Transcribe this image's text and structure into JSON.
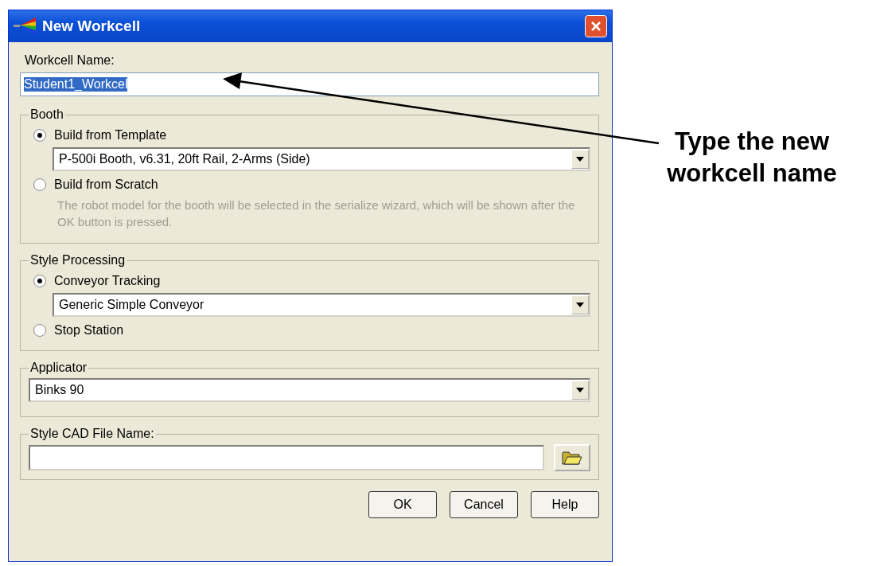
{
  "window": {
    "title": "New Workcell"
  },
  "workcell_name": {
    "label": "Workcell Name:",
    "value": "Student1_Workcel",
    "text_selected": true
  },
  "groups": [
    {
      "title": "Booth",
      "kind": "radio",
      "options": [
        {
          "label": "Build from Template",
          "selected": true,
          "dropdown": "P-500i Booth, v6.31, 20ft Rail, 2-Arms (Side)"
        },
        {
          "label": "Build from Scratch",
          "selected": false,
          "note": "The robot model for the booth will be selected in the serialize wizard, which will be shown after the OK button is pressed.",
          "note_disabled": true
        }
      ]
    },
    {
      "title": "Style Processing",
      "kind": "radio",
      "options": [
        {
          "label": "Conveyor Tracking",
          "selected": true,
          "dropdown": "Generic Simple Conveyor"
        },
        {
          "label": "Stop Station",
          "selected": false
        }
      ]
    },
    {
      "title": "Applicator",
      "kind": "dropdown",
      "value": "Binks 90"
    },
    {
      "title": "Style CAD File Name:",
      "kind": "file"
    }
  ],
  "buttons": [
    "OK",
    "Cancel",
    "Help"
  ],
  "annotation": {
    "text": "Type the new workcell name"
  }
}
